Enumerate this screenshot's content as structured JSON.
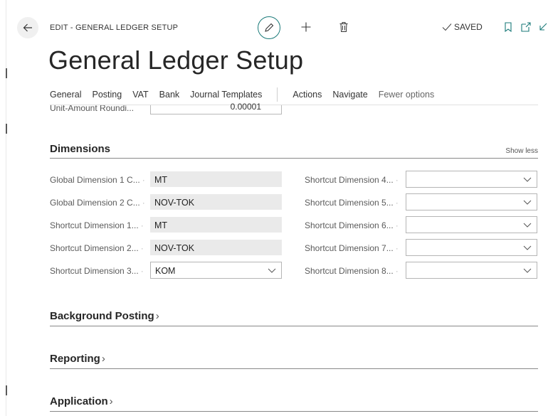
{
  "header": {
    "caption": "EDIT - GENERAL LEDGER SETUP",
    "saved_label": "SAVED",
    "title": "General Ledger Setup"
  },
  "actionbar": {
    "tabs": [
      "General",
      "Posting",
      "VAT",
      "Bank",
      "Journal Templates"
    ],
    "actions": [
      "Actions",
      "Navigate"
    ],
    "fewer_options": "Fewer options"
  },
  "partial_field": {
    "label": "Unit-Amount Roundi...",
    "value": "0.00001"
  },
  "dimensions": {
    "title": "Dimensions",
    "show_less": "Show less",
    "left_fields": [
      {
        "label": "Global Dimension 1 C...",
        "value": "MT"
      },
      {
        "label": "Global Dimension 2 C...",
        "value": "NOV-TOK"
      },
      {
        "label": "Shortcut Dimension 1...",
        "value": "MT"
      },
      {
        "label": "Shortcut Dimension 2...",
        "value": "NOV-TOK"
      },
      {
        "label": "Shortcut Dimension 3...",
        "value": "KOM"
      }
    ],
    "right_fields": [
      {
        "label": "Shortcut Dimension 4...",
        "value": ""
      },
      {
        "label": "Shortcut Dimension 5...",
        "value": ""
      },
      {
        "label": "Shortcut Dimension 6...",
        "value": ""
      },
      {
        "label": "Shortcut Dimension 7...",
        "value": ""
      },
      {
        "label": "Shortcut Dimension 8...",
        "value": ""
      }
    ]
  },
  "sections": [
    {
      "title": "Background Posting"
    },
    {
      "title": "Reporting"
    },
    {
      "title": "Application"
    }
  ],
  "icons": {
    "back": "arrow-left-icon",
    "edit": "pencil-icon",
    "new": "plus-icon",
    "delete": "trash-icon",
    "saved": "checkmark-icon",
    "bookmark": "bookmark-icon",
    "open_new": "open-in-new-window-icon",
    "collapse": "collapse-icon",
    "dropdown": "chevron-down-icon",
    "expand": "chevron-right-icon"
  },
  "colors": {
    "accent": "#1a7a79",
    "readonly_field_bg": "#eaeaea"
  }
}
